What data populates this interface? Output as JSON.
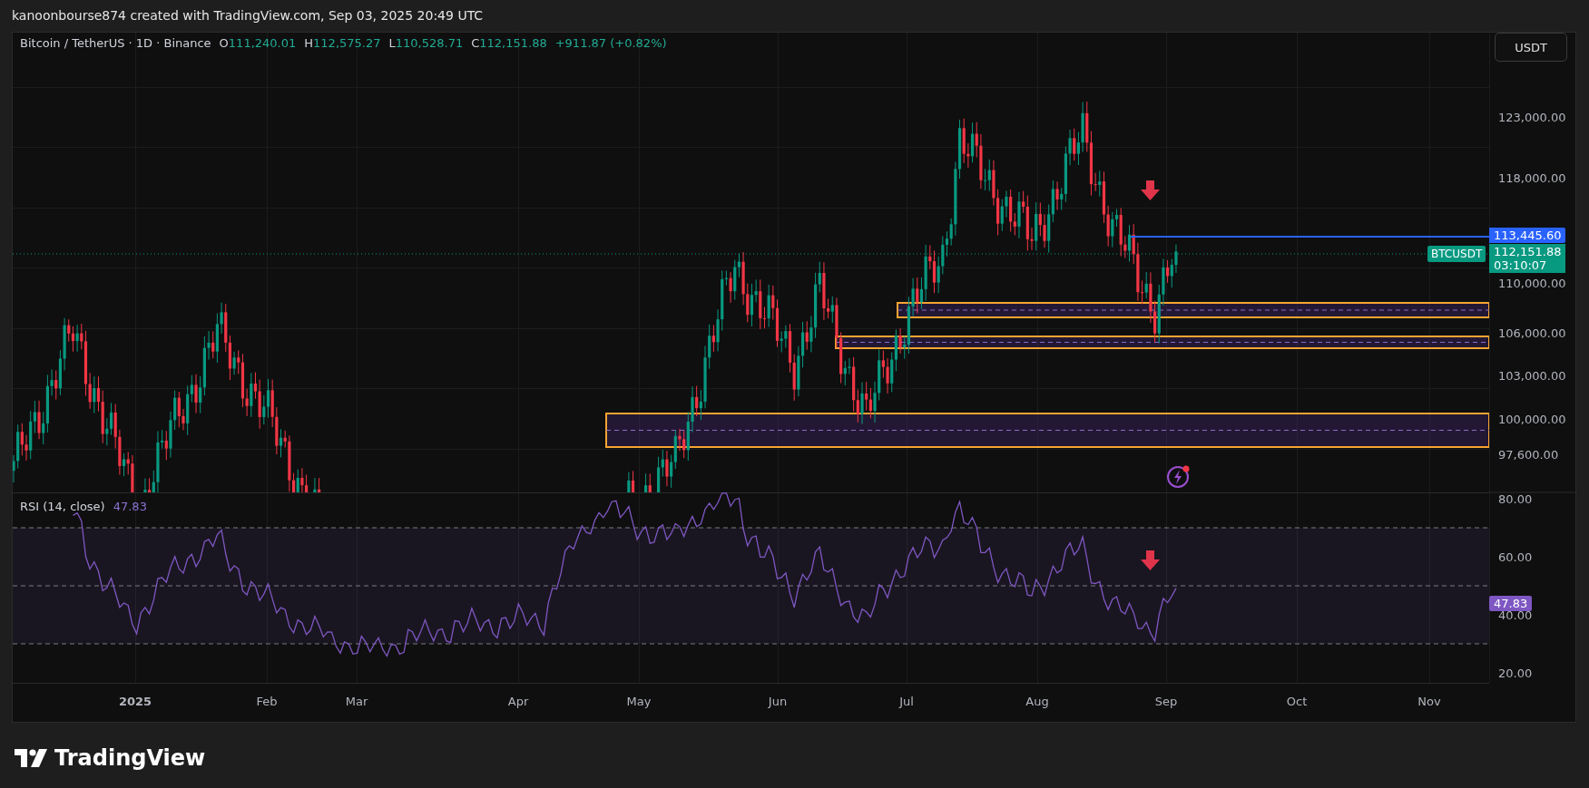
{
  "header": {
    "text": "kanoonbourse874 created with TradingView.com, Sep 03, 2025 20:49 UTC"
  },
  "legend": {
    "symbol": "Bitcoin / TetherUS · 1D · Binance",
    "ohlc": [
      {
        "label": "O",
        "value": "111,240.01"
      },
      {
        "label": "H",
        "value": "112,575.27"
      },
      {
        "label": "L",
        "value": "110,528.71"
      },
      {
        "label": "C",
        "value": "112,151.88"
      }
    ],
    "change": "+911.87 (+0.82%)"
  },
  "currency_button": "USDT",
  "price_axis": [
    "123,000.00",
    "118,000.00",
    "110,000.00",
    "106,000.00",
    "103,000.00",
    "100,000.00",
    "97,600.00"
  ],
  "line_price_label": "113,445.60",
  "last_price": {
    "value": "112,151.88",
    "countdown": "03:10:07"
  },
  "symbol_tag": "BTCUSDT",
  "rsi": {
    "title": "RSI (14, close)",
    "value": "47.83",
    "axis": [
      "80.00",
      "60.00",
      "40.00",
      "20.00"
    ],
    "badge": "47.83"
  },
  "time_axis": [
    "2025",
    "Feb",
    "Mar",
    "Apr",
    "May",
    "Jun",
    "Jul",
    "Aug",
    "Sep",
    "Oct",
    "Nov"
  ],
  "logo": "TradingView"
}
